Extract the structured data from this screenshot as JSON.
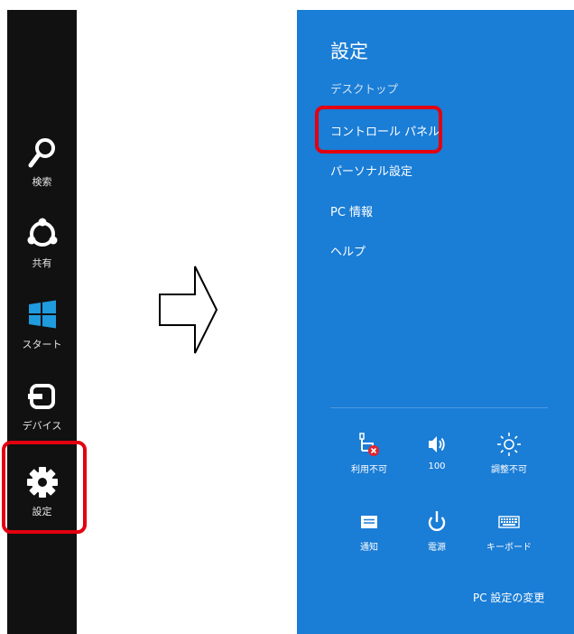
{
  "charms": [
    {
      "label": "検索",
      "icon": "search-icon"
    },
    {
      "label": "共有",
      "icon": "share-icon"
    },
    {
      "label": "スタート",
      "icon": "windows-start-icon"
    },
    {
      "label": "デバイス",
      "icon": "devices-icon"
    },
    {
      "label": "設定",
      "icon": "gear-icon"
    }
  ],
  "settings_pane": {
    "title": "設定",
    "subtitle": "デスクトップ",
    "items": [
      {
        "label": "コントロール パネル"
      },
      {
        "label": "パーソナル設定"
      },
      {
        "label": "PC 情報"
      },
      {
        "label": "ヘルプ"
      }
    ],
    "quick_settings": [
      {
        "label": "利用不可",
        "icon": "network-unavailable-icon"
      },
      {
        "label": "100",
        "icon": "volume-icon"
      },
      {
        "label": "調整不可",
        "icon": "brightness-icon"
      },
      {
        "label": "通知",
        "icon": "notifications-icon"
      },
      {
        "label": "電源",
        "icon": "power-icon"
      },
      {
        "label": "キーボード",
        "icon": "keyboard-icon"
      }
    ],
    "change_pc_settings": "PC 設定の変更"
  },
  "colors": {
    "pane_bg": "#1a7dd6",
    "charms_bg": "#111111",
    "highlight": "#e3000f"
  }
}
